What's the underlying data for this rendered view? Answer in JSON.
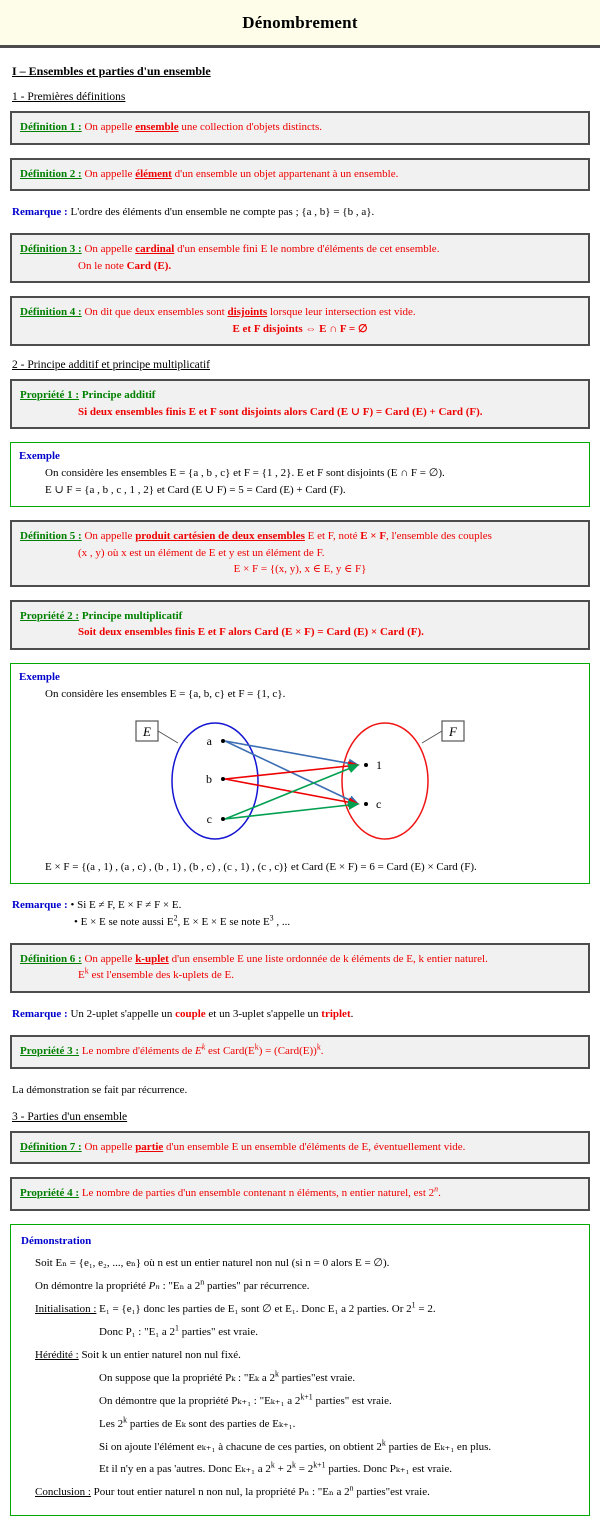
{
  "document": {
    "title": "Dénombrement"
  },
  "chapter": {
    "heading": "I – Ensembles et parties d'un ensemble"
  },
  "sections": {
    "s1": "1 - Premières définitions",
    "s2": "2 - Principe additif et principe multiplicatif",
    "s3": "3 - Parties d'un ensemble"
  },
  "labels": {
    "def1": "Définition 1 :",
    "def2": "Définition 2 :",
    "def3": "Définition 3 :",
    "def4": "Définition 4 :",
    "def5": "Définition 5 :",
    "def6": "Définition 6 :",
    "def7": "Définition 7 :",
    "prop1": "Propriété 1 :",
    "prop2": "Propriété 2 :",
    "prop3": "Propriété 3 :",
    "prop4": "Propriété 4 :",
    "remarque": "Remarque :",
    "exemple": "Exemple",
    "demonstration": "Démonstration",
    "initialisation": "Initialisation :",
    "heredite": "Hérédité :",
    "conclusion": "Conclusion :"
  },
  "def1": {
    "lead": "On appelle",
    "term": "ensemble",
    "tail": "une collection d'objets distincts."
  },
  "def2": {
    "lead": "On appelle",
    "term": "élément",
    "tail": "d'un ensemble un objet appartenant à un ensemble."
  },
  "remarque1": {
    "text": "L'ordre des éléments d'un ensemble ne compte pas ; {a , b} = {b , a}."
  },
  "def3": {
    "lead": "On appelle",
    "term": "cardinal",
    "tail": "d'un ensemble fini E le nombre d'éléments de cet ensemble.",
    "line2_lead": "On le note",
    "line2_bold": "Card (E)."
  },
  "def4": {
    "text": "On dit que deux ensembles sont",
    "term": "disjoints",
    "tail": "lorsque leur intersection est vide.",
    "formula": "E et F disjoints ⇔ E ∩ F = ∅"
  },
  "prop1": {
    "subtitle": "Principe additif",
    "body": "Si deux ensembles finis E et F sont disjoints alors Card (E ∪ F) = Card (E) + Card (F)."
  },
  "exemple1": {
    "line1": "On considère les ensembles E = {a , b , c} et F = {1 , 2}. E et F sont disjoints (E ∩ F = ∅).",
    "line2": "E ∪ F = {a , b , c , 1 , 2} et Card (E ∪ F) = 5 = Card (E) + Card (F)."
  },
  "def5": {
    "lead": "On appelle",
    "term": "produit cartésien de deux ensembles",
    "tail1": "E et F, noté",
    "notation": "E × F",
    "tail2": ", l'ensemble des couples",
    "line2": "(x , y) où x est un élément de E et y est un élément de F.",
    "formula": "E × F = {(x, y), x ∈ E, y ∈ F}"
  },
  "prop2": {
    "subtitle": "Principe multiplicatif",
    "body": "Soit deux ensembles finis E et F alors Card (E × F) = Card (E) × Card (F)."
  },
  "exemple2": {
    "line1": "On considère les ensembles E = {a, b, c} et F = {1, c}.",
    "result": "E × F = {(a , 1) , (a , c) , (b , 1) , (b , c) , (c , 1) , (c , c)} et Card (E × F) = 6 = Card (E) × Card (F)."
  },
  "diagram": {
    "set_e_label": "E",
    "set_f_label": "F",
    "e_elements": [
      "a",
      "b",
      "c"
    ],
    "f_elements": [
      "1",
      "c"
    ],
    "colors": {
      "set_e": "#1414d2",
      "set_f": "#f01414",
      "arrow_a": "#3c6eb4",
      "arrow_b": "#ee0000",
      "arrow_c": "#00a050"
    },
    "arrows": [
      {
        "from": "a",
        "to": "1",
        "color": "#3c6eb4"
      },
      {
        "from": "a",
        "to": "c",
        "color": "#3c6eb4"
      },
      {
        "from": "b",
        "to": "1",
        "color": "#ee0000"
      },
      {
        "from": "b",
        "to": "c",
        "color": "#ee0000"
      },
      {
        "from": "c",
        "to": "1",
        "color": "#00a050"
      },
      {
        "from": "c",
        "to": "c",
        "color": "#00a050"
      }
    ]
  },
  "remarque2": {
    "b1": "• Si E ≠ F, E × F ≠ F × E.",
    "b2_pre": "• E × E se note aussi E",
    "b2_sup1": "2",
    "b2_mid": ", E × E × E se note E",
    "b2_sup2": "3",
    "b2_end": " , ..."
  },
  "def6": {
    "lead": "On appelle",
    "term": "k-uplet",
    "tail": "d'un ensemble E une liste ordonnée de k éléments de E, k entier naturel.",
    "line2_pre": "E",
    "line2_sup": "k",
    "line2_tail": " est l'ensemble des k-uplets de E."
  },
  "remarque3": {
    "pre": "Un 2-uplet s'appelle un",
    "t1": "couple",
    "mid": "et un 3-uplet s'appelle un",
    "t2": "triplet",
    "end": "."
  },
  "prop3": {
    "pre": "Le nombre d'éléments de",
    "sym": "E",
    "sym_sup": "k",
    "mid": "est",
    "formula": "Card(E",
    "formula_sup1": "k",
    "formula_mid": ") = (Card(E))",
    "formula_sup2": "k",
    "formula_end": "."
  },
  "recurrence_note": "La démonstration se fait par récurrence.",
  "def7": {
    "lead": "On appelle",
    "term": "partie",
    "tail": "d'un ensemble E un ensemble d'éléments de E, éventuellement vide."
  },
  "prop4": {
    "pre": "Le nombre de parties d'un ensemble contenant n éléments, n entier naturel, est",
    "val": "2",
    "val_sup": "n",
    "end": "."
  },
  "demonstration": {
    "l1_pre": "Soit E",
    "l1_sub": "n",
    "l1_mid": " = {e",
    "l1_body": "₁, e₂, ..., eₙ}  où n est un entier naturel non nul (si n = 0 alors E = ∅).",
    "l1": "Soit Eₙ = {e₁, e₂, ..., eₙ}  où n est un entier naturel non nul (si n = 0 alors E = ∅).",
    "l2_pre": "On démontre la propriété ",
    "l2_p": "Pₙ",
    "l2_mid": " : \"Eₙ a 2",
    "l2_sup": "n",
    "l2_end": " parties\" par récurrence.",
    "init_l1_pre": "E₁ = {e₁} donc les parties de E₁ sont ∅ et E₁. Donc E₁ a 2 parties. Or 2",
    "init_l1_sup": "1",
    "init_l1_end": " = 2.",
    "init_l2_pre": "Donc P₁ : \"E₁ a 2",
    "init_l2_sup": "1",
    "init_l2_end": " parties\" est vraie.",
    "her_l0": "Soit k un entier naturel non nul fixé.",
    "her_l1_pre": "On suppose que la propriété Pₖ : \"Eₖ a 2",
    "her_l1_sup": "k",
    "her_l1_end": " parties\"est vraie.",
    "her_l2_pre": "On démontre que la propriété Pₖ₊₁ : \"Eₖ₊₁ a 2",
    "her_l2_sup": "k+1",
    "her_l2_end": " parties\" est vraie.",
    "her_l3_pre": "Les 2",
    "her_l3_sup": "k",
    "her_l3_end": " parties de Eₖ sont des parties de Eₖ₊₁.",
    "her_l4_pre": "Si on ajoute l'élément eₖ₊₁ à chacune de ces parties, on obtient 2",
    "her_l4_sup": "k",
    "her_l4_end": " parties de Eₖ₊₁ en plus.",
    "her_l5_pre": "Et il n'y en a pas 'autres. Donc Eₖ₊₁ a 2",
    "her_l5_sup1": "k",
    "her_l5_mid": " + 2",
    "her_l5_sup2": "k",
    "her_l5_mid2": " = 2",
    "her_l5_sup3": "k+1",
    "her_l5_end": " parties.  Donc Pₖ₊₁ est vraie.",
    "conc_pre": "Pour tout entier naturel n non nul, la propriété Pₙ : \"Eₙ a 2",
    "conc_sup": "n",
    "conc_end": " parties\"est vraie."
  }
}
